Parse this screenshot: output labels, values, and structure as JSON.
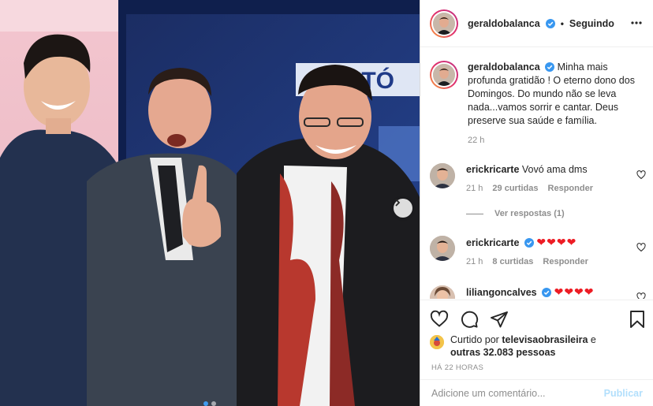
{
  "post": {
    "author": "geraldobalanca",
    "follow_status": "Seguindo",
    "separator": "•",
    "caption": "Minha mais profunda gratidão ! O eterno dono dos Domingos. Do mundo não se leva nada...vamos sorrir e cantar. Deus preserve sua saúde e família.",
    "caption_time": "22 h"
  },
  "photo": {
    "backdrop_text": "AUDITÓ",
    "carousel_dots": 2,
    "active_dot": 0
  },
  "comments": [
    {
      "user": "erickricarte",
      "verified": false,
      "text": "Vovó ama dms",
      "time": "21 h",
      "likes": "29 curtidas",
      "reply": "Responder",
      "view_replies": "Ver respostas (1)"
    },
    {
      "user": "erickricarte",
      "verified": true,
      "text": "❤❤❤❤",
      "time": "21 h",
      "likes": "8 curtidas",
      "reply": "Responder"
    },
    {
      "user": "liliangoncalves",
      "verified": true,
      "text": "❤❤❤❤"
    }
  ],
  "likes": {
    "prefix": "Curtido por",
    "user": "televisaobrasileira",
    "joiner": "e",
    "others": "outras 32.083 pessoas"
  },
  "timestamp": "HÁ 22 HORAS",
  "add_comment": {
    "placeholder": "Adicione um comentário...",
    "publish_label": "Publicar"
  },
  "colors": {
    "verified": "#3897f0",
    "heart": "#ed1c24",
    "publish_disabled": "#b2dffc",
    "muted": "#8e8e8e"
  }
}
